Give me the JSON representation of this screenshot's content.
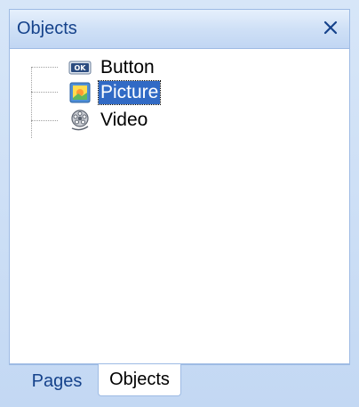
{
  "panel": {
    "title": "Objects",
    "close_symbol": "✕"
  },
  "tree": {
    "items": [
      {
        "label": "Button",
        "icon": "button-ok-icon",
        "selected": false
      },
      {
        "label": "Picture",
        "icon": "picture-icon",
        "selected": true
      },
      {
        "label": "Video",
        "icon": "video-reel-icon",
        "selected": false
      }
    ]
  },
  "tabs": [
    {
      "label": "Pages",
      "active": false
    },
    {
      "label": "Objects",
      "active": true
    }
  ]
}
